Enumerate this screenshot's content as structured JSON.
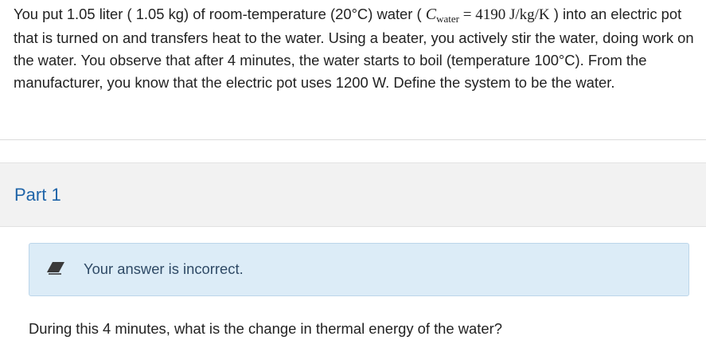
{
  "problem": {
    "text_before": "You put 1.05 liter ( 1.05 kg) of room-temperature (20°C) water ( ",
    "math_var": "C",
    "math_sub": "water",
    "math_eq": " = 4190 J/kg/K",
    "text_after": " ) into an electric pot that is turned on and transfers heat to the water. Using a beater, you actively stir the water, doing work on the water. You observe that after 4 minutes, the water starts to boil (temperature 100°C). From the manufacturer, you know that the electric pot uses 1200 W. Define the system to be the water."
  },
  "part": {
    "title": "Part 1"
  },
  "feedback": {
    "icon": "eraser-icon",
    "message": "Your answer is incorrect."
  },
  "question": {
    "text": "During this 4 minutes, what is the change in thermal energy of the water?"
  },
  "colors": {
    "part_title": "#1f64a8",
    "feedback_bg": "#dcecf7",
    "part_bg": "#f2f2f2"
  }
}
